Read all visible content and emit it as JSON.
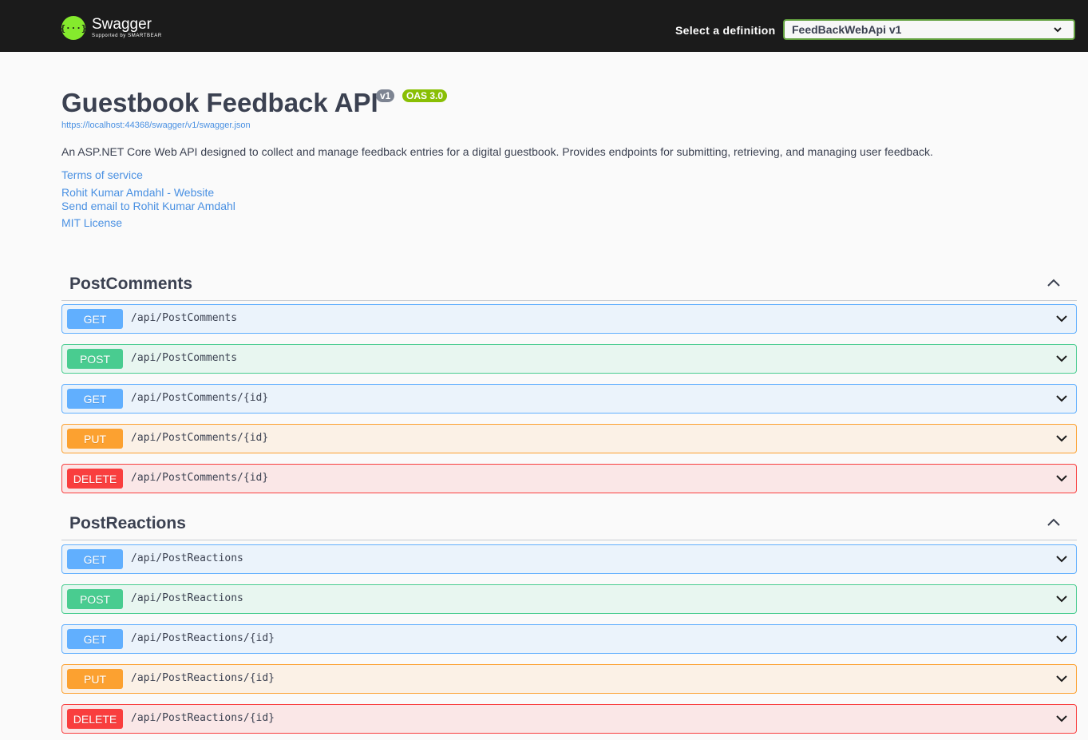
{
  "header": {
    "logo_name": "Swagger",
    "logo_sub": "Supported by SMARTBEAR",
    "definition_label": "Select a definition",
    "definition_value": "FeedBackWebApi v1"
  },
  "info": {
    "title": "Guestbook Feedback API",
    "version_badge": "v1",
    "oas_badge": "OAS 3.0",
    "url": "https://localhost:44368/swagger/v1/swagger.json",
    "description": "An ASP.NET Core Web API designed to collect and manage feedback entries for a digital guestbook. Provides endpoints for submitting, retrieving, and managing user feedback.",
    "terms": "Terms of service",
    "contact_website": "Rohit Kumar Amdahl - Website",
    "contact_email": "Send email to Rohit Kumar Amdahl",
    "license": "MIT License"
  },
  "sections": [
    {
      "name": "PostComments",
      "operations": [
        {
          "method": "GET",
          "path": "/api/PostComments"
        },
        {
          "method": "POST",
          "path": "/api/PostComments"
        },
        {
          "method": "GET",
          "path": "/api/PostComments/{id}"
        },
        {
          "method": "PUT",
          "path": "/api/PostComments/{id}"
        },
        {
          "method": "DELETE",
          "path": "/api/PostComments/{id}"
        }
      ]
    },
    {
      "name": "PostReactions",
      "operations": [
        {
          "method": "GET",
          "path": "/api/PostReactions"
        },
        {
          "method": "POST",
          "path": "/api/PostReactions"
        },
        {
          "method": "GET",
          "path": "/api/PostReactions/{id}"
        },
        {
          "method": "PUT",
          "path": "/api/PostReactions/{id}"
        },
        {
          "method": "DELETE",
          "path": "/api/PostReactions/{id}"
        }
      ]
    }
  ],
  "colors": {
    "get": "#61affe",
    "post": "#49cc90",
    "put": "#fca130",
    "delete": "#f93e3e",
    "topbar": "#1b1b1b",
    "swagger_green": "#85ea2d"
  }
}
